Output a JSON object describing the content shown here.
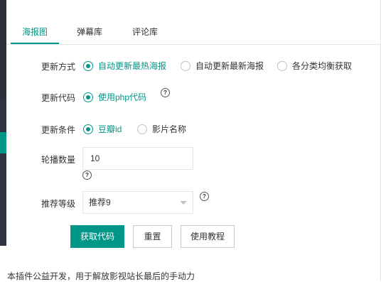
{
  "tabs": [
    {
      "label": "海报图",
      "active": true
    },
    {
      "label": "弹幕库",
      "active": false
    },
    {
      "label": "评论库",
      "active": false
    }
  ],
  "form": {
    "update_mode": {
      "label": "更新方式",
      "options": [
        "自动更新最热海报",
        "自动更新最新海报",
        "各分类均衡获取"
      ],
      "selected": "自动更新最热海报"
    },
    "update_code": {
      "label": "更新代码",
      "options": [
        "使用php代码"
      ],
      "selected": "使用php代码",
      "help_icon": "?"
    },
    "update_condition": {
      "label": "更新条件",
      "options": [
        "豆瓣id",
        "影片名称"
      ],
      "selected": "豆瓣id"
    },
    "carousel_count": {
      "label": "轮播数量",
      "value": "10",
      "help_icon": "?"
    },
    "recommend_level": {
      "label": "推荐等级",
      "value": "推荐9",
      "help_icon": "?"
    }
  },
  "buttons": {
    "get_code": "获取代码",
    "reset": "重置",
    "tutorial": "使用教程"
  },
  "footer": "本插件公益开发，用于解放影视站长最后的手动力",
  "colors": {
    "accent": "#009688",
    "sidebar_dark": "#2f3440",
    "border": "#e6e6e6"
  }
}
